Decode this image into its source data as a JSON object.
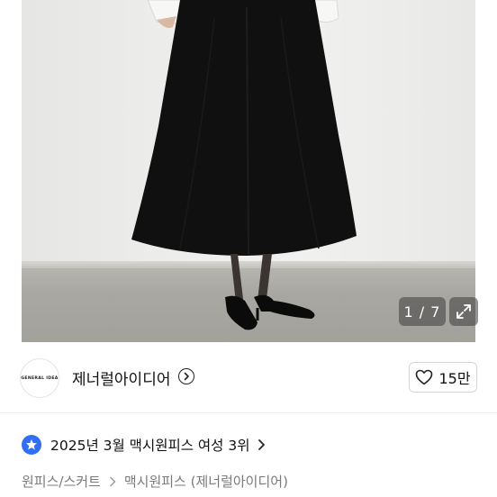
{
  "gallery": {
    "counter": "1 / 7",
    "expand_icon": "expand-arrows-icon"
  },
  "shop": {
    "logo_text": "GENERAL IDEA",
    "name": "제너럴아이디어",
    "chevron_icon": "chevron-right-circle-icon",
    "likes": "15만",
    "like_icon": "heart-outline-icon"
  },
  "ranking": {
    "icon": "star-badge-icon",
    "text": "2025년 3월 맥시원피스 여성 3위"
  },
  "breadcrumb": {
    "items": [
      "원피스/스커트",
      "맥시원피스 (제너럴아이디어)"
    ]
  },
  "colors": {
    "accent": "#2f6ef5",
    "text": "#111111",
    "muted": "#7a7a7a"
  }
}
